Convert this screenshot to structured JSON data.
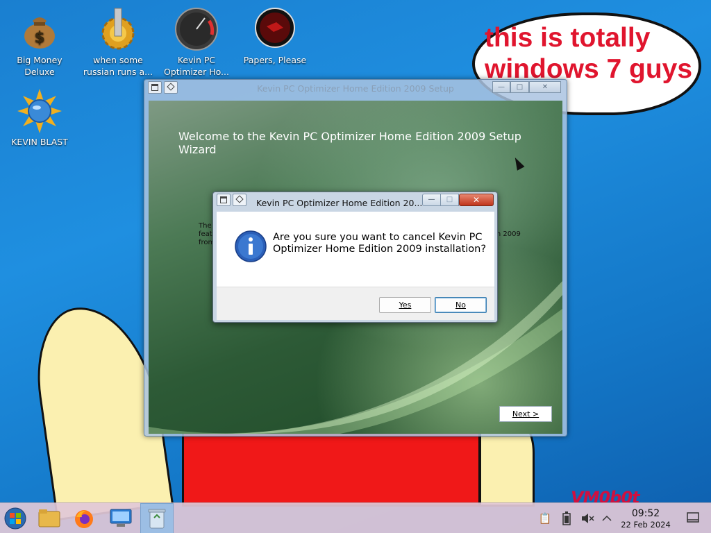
{
  "desktop": {
    "icons": [
      {
        "label": "Big Money Deluxe",
        "icon": "money-bag-icon"
      },
      {
        "label": "when some russian runs a...",
        "icon": "gears-icon"
      },
      {
        "label": "Kevin PC Optimizer Ho...",
        "icon": "speedometer-icon"
      },
      {
        "label": "Papers, Please",
        "icon": "papers-please-icon"
      },
      {
        "label": "KEVIN BLAST",
        "icon": "globe-sun-icon"
      }
    ],
    "bubble_text": "this is totally windows 7 guys",
    "signature": "VM0b0t"
  },
  "setup_window": {
    "title": "Kevin PC Optimizer Home Edition 2009 Setup",
    "welcome": "Welcome to the Kevin PC Optimizer Home Edition 2009 Setup Wizard",
    "body_fragments": [
      "The",
      "feat",
      "from",
      "ion 2009"
    ],
    "next_label": "Next >"
  },
  "dialog": {
    "title": "Kevin PC Optimizer Home Edition 20...",
    "message": "Are you sure you want to cancel Kevin PC Optimizer Home Edition 2009 installation?",
    "yes_label": "Yes",
    "no_label": "No",
    "icon": "info-icon"
  },
  "taskbar": {
    "start_icon": "start-orb-icon",
    "pinned": [
      "file-manager-icon",
      "firefox-icon",
      "system-monitor-icon",
      "recycle-bin-icon"
    ],
    "tray": [
      "clipboard-icon",
      "battery-icon",
      "volume-muted-icon",
      "chevron-up-icon"
    ],
    "time": "09:52",
    "date": "22 Feb 2024",
    "show_desktop_icon": "show-desktop-icon"
  }
}
